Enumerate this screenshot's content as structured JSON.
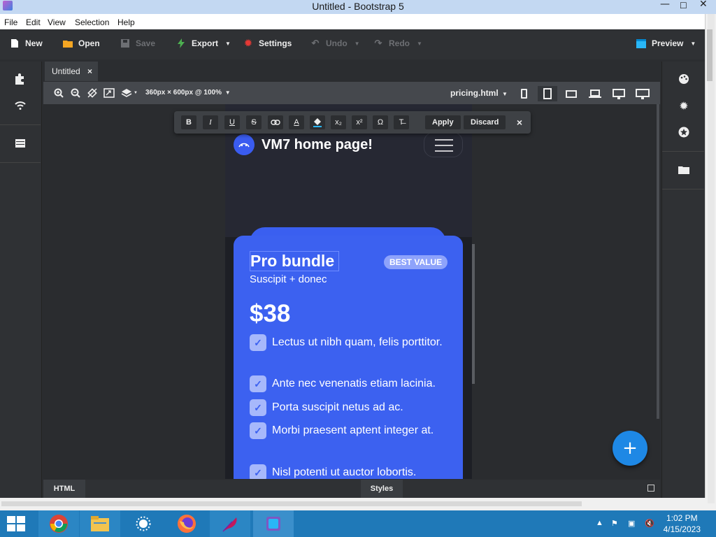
{
  "window": {
    "title": "Untitled - Bootstrap 5",
    "controls": [
      "—",
      "☐",
      "✕"
    ]
  },
  "menu": [
    "File",
    "Edit",
    "View",
    "Selection",
    "Help"
  ],
  "toolbar": {
    "new": "New",
    "open": "Open",
    "save": "Save",
    "export": "Export",
    "settings": "Settings",
    "undo": "Undo",
    "redo": "Redo",
    "preview": "Preview"
  },
  "tabs": [
    {
      "label": "Untitled",
      "close": "×"
    }
  ],
  "editor": {
    "size": "360px × 600px @ 100%",
    "file": "pricing.html"
  },
  "format_bar": {
    "buttons": [
      "B",
      "I",
      "U",
      "S",
      "🔗",
      "A",
      "◈",
      "x₂",
      "x²",
      "Ω",
      "T̶"
    ],
    "apply": "Apply",
    "discard": "Discard",
    "close": "×"
  },
  "preview": {
    "brand": "VM7 home page!",
    "button": "Button",
    "card": {
      "title": "Pro bundle",
      "badge": "BEST VALUE",
      "subtitle": "Suscipit + donec",
      "price": "$38",
      "features": [
        "Lectus ut nibh quam, felis porttitor.",
        "Ante nec venenatis etiam lacinia.",
        "Porta suscipit netus ad ac.",
        "Morbi praesent aptent integer at.",
        "Nisl potenti ut auctor lobortis."
      ]
    }
  },
  "fab": "+",
  "bottom": {
    "html": "HTML",
    "styles": "Styles"
  },
  "clock": {
    "time": "1:02 PM",
    "date": "4/15/2023"
  },
  "colors": {
    "accent": "#3c61f0",
    "fab": "#1e88e5",
    "taskbar": "#1f79b8"
  }
}
